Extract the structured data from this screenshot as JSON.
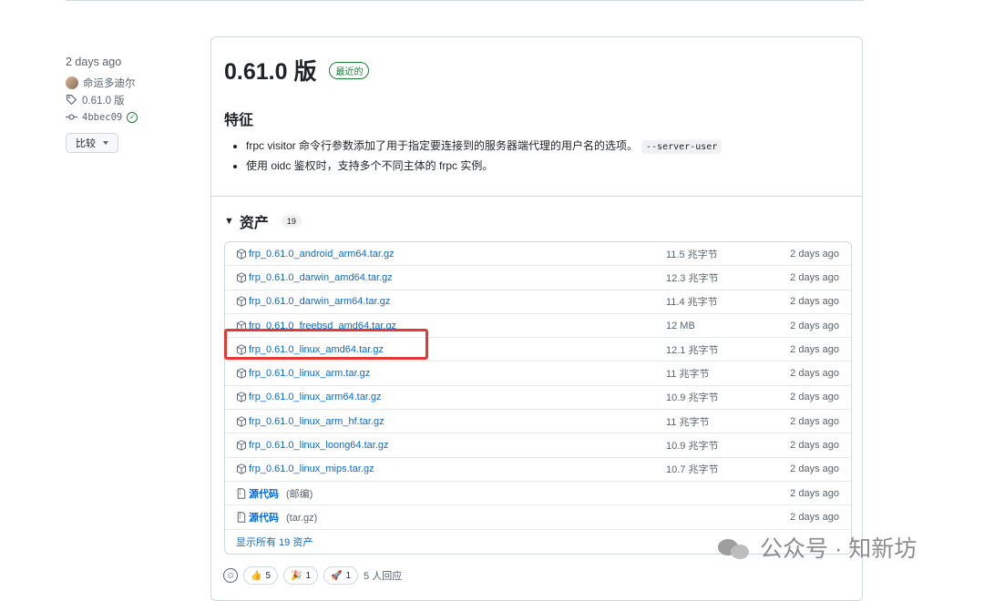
{
  "meta": {
    "date": "2 days ago",
    "author": "命运多迪尔",
    "tag": "0.61.0 版",
    "commit": "4bbec09",
    "compare_label": "比较"
  },
  "release": {
    "title": "0.61.0 版",
    "badge": "最近的",
    "features_heading": "特征",
    "bullets": [
      {
        "text": "frpc visitor 命令行参数添加了用于指定要连接到的服务器端代理的用户名的选项。",
        "code": "--server-user"
      },
      {
        "text": "使用 oidc 鉴权时，支持多个不同主体的 frpc 实例。",
        "code": ""
      }
    ],
    "assets_heading": "资产",
    "assets_count": "19",
    "assets": [
      {
        "name": "frp_0.61.0_android_arm64.tar.gz",
        "size": "11.5 兆字节",
        "date": "2 days ago"
      },
      {
        "name": "frp_0.61.0_darwin_amd64.tar.gz",
        "size": "12.3 兆字节",
        "date": "2 days ago"
      },
      {
        "name": "frp_0.61.0_darwin_arm64.tar.gz",
        "size": "11.4 兆字节",
        "date": "2 days ago"
      },
      {
        "name": "frp_0.61.0_freebsd_amd64.tar.gz",
        "size": "12 MB",
        "date": "2 days ago"
      },
      {
        "name": "frp_0.61.0_linux_amd64.tar.gz",
        "size": "12.1 兆字节",
        "date": "2 days ago"
      },
      {
        "name": "frp_0.61.0_linux_arm.tar.gz",
        "size": "11 兆字节",
        "date": "2 days ago"
      },
      {
        "name": "frp_0.61.0_linux_arm64.tar.gz",
        "size": "10.9 兆字节",
        "date": "2 days ago"
      },
      {
        "name": "frp_0.61.0_linux_arm_hf.tar.gz",
        "size": "11 兆字节",
        "date": "2 days ago"
      },
      {
        "name": "frp_0.61.0_linux_loong64.tar.gz",
        "size": "10.9 兆字节",
        "date": "2 days ago"
      },
      {
        "name": "frp_0.61.0_linux_mips.tar.gz",
        "size": "10.7 兆字节",
        "date": "2 days ago"
      }
    ],
    "source": [
      {
        "name": "源代码",
        "sub": "(邮编)",
        "date": "2 days ago"
      },
      {
        "name": "源代码",
        "sub": "(tar.gz)",
        "date": "2 days ago"
      }
    ],
    "show_all": "显示所有 19 资产",
    "reactions": {
      "thumbs": "5",
      "party": "1",
      "rocket": "1",
      "summary": "5 人回应"
    }
  },
  "watermark": "公众号 · 知新坊",
  "icons": [
    "tag-icon",
    "commit-icon",
    "check-circle-icon",
    "package-icon",
    "file-zip-icon",
    "smiley-icon",
    "thumbs-up-icon",
    "tada-icon",
    "rocket-icon",
    "wechat-icon"
  ],
  "colors": {
    "link": "#0969da",
    "badge": "#1a7f37",
    "highlight": "#e53935"
  }
}
